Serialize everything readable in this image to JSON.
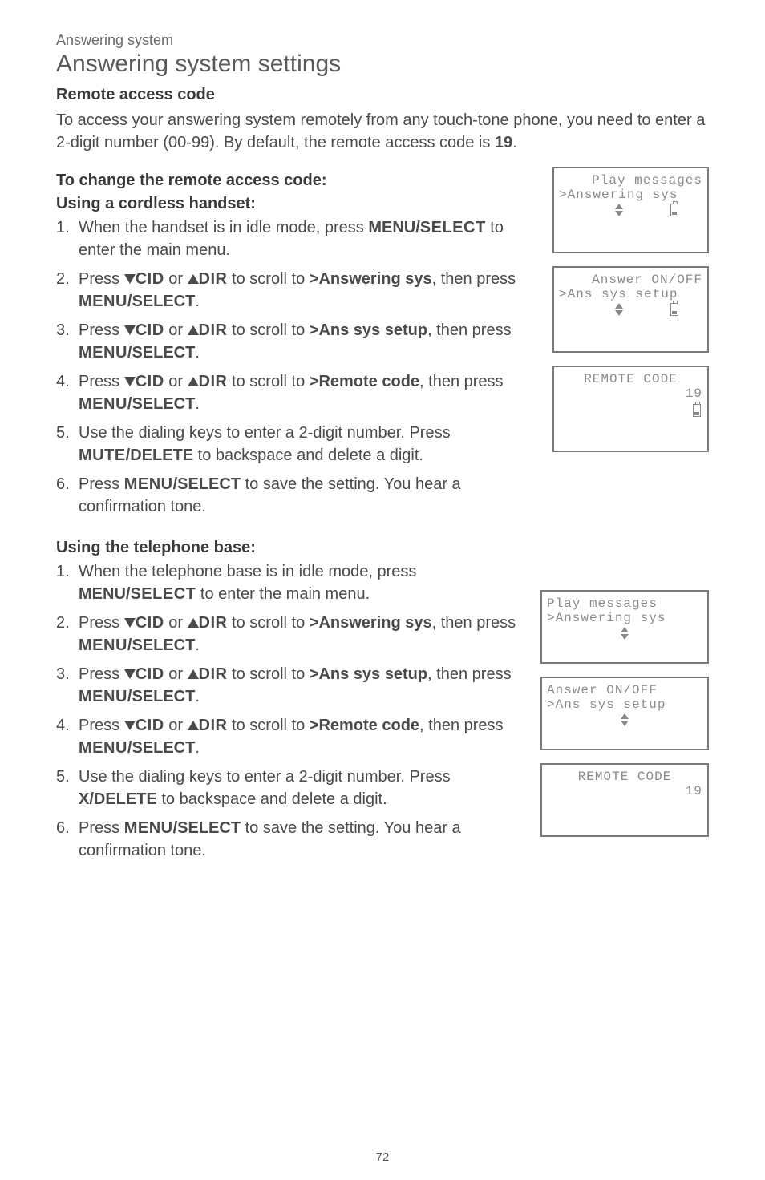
{
  "breadcrumb": "Answering system",
  "page_title": "Answering system settings",
  "section_heading": "Remote access code",
  "intro_pre": "To access your answering system remotely from any touch-tone phone, you need to enter a 2-digit number (00-99). By default, the remote access code is ",
  "intro_code": "19",
  "intro_post": ".",
  "change_heading": "To change the remote access code:",
  "handset_heading": "Using a cordless handset:",
  "base_heading": "Using the telephone base:",
  "labels": {
    "menu_select_caps": "MENU/",
    "select_sc": "SELECT",
    "menu_sc": "MENU",
    "select_caps": "/SELECT",
    "cid": "CID",
    "dir": "DIR",
    "mute_sc": "MUTE",
    "delete_caps": "/DELETE",
    "x_delete": "X/DELETE",
    "answering_sys": ">Answering sys",
    "ans_sys_setup": ">Ans sys setup",
    "remote_code": ">Remote code"
  },
  "handset_steps": {
    "s1a": "When the handset is in idle mode, press ",
    "s1b": " to enter the main menu.",
    "s2a": "Press ",
    "s2b": " or ",
    "s2c": " to scroll to ",
    "s2d": ", then press ",
    "s2e": ".",
    "s5a": "Use the dialing keys to enter a 2-digit number. Press ",
    "s5b": " to backspace and delete a digit.",
    "s6a": "Press ",
    "s6b": " to save the setting. You hear a confirmation tone."
  },
  "base_steps": {
    "s1a": "When the telephone base is in idle mode, press ",
    "s1b": " to enter the main menu."
  },
  "lcd": {
    "play_messages": " Play messages",
    "answering_sys": ">Answering sys",
    "answer_onoff": " Answer ON/OFF",
    "ans_sys_setup": ">Ans sys setup",
    "remote_code": "REMOTE CODE",
    "code_value": "19"
  },
  "page_number": "72"
}
